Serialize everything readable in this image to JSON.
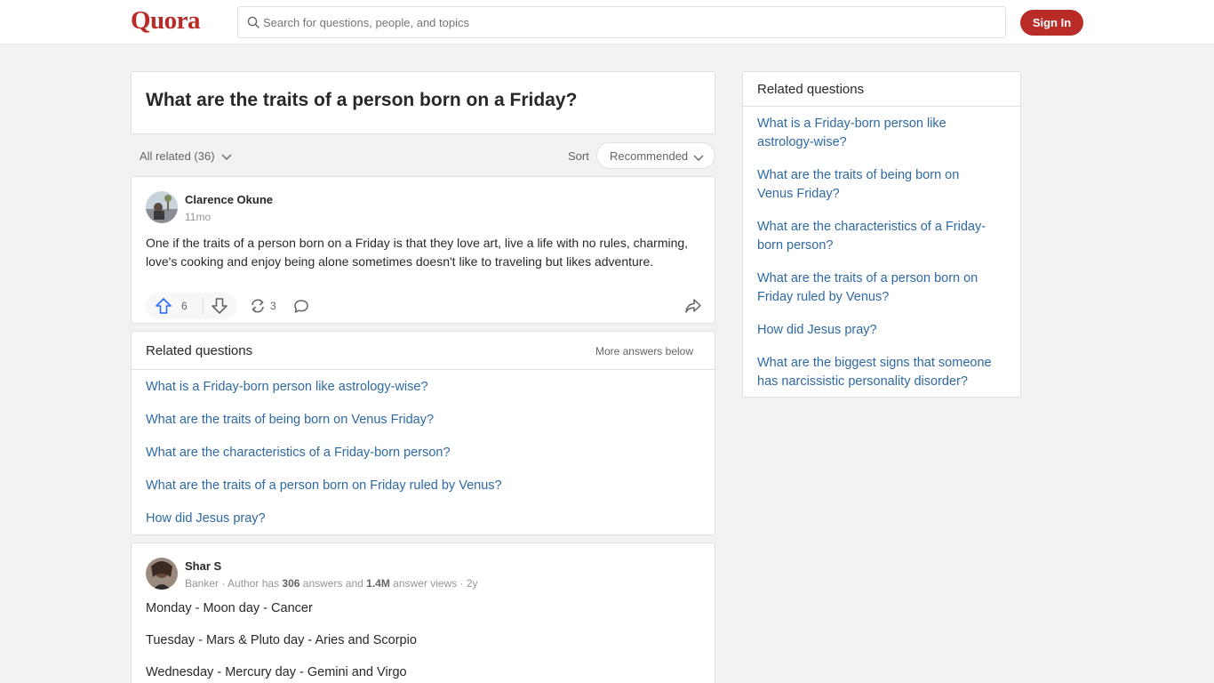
{
  "header": {
    "logo": "Quora",
    "search_placeholder": "Search for questions, people, and topics",
    "signin_label": "Sign In"
  },
  "question": {
    "title": "What are the traits of a person born on a Friday?"
  },
  "filters": {
    "all_related": "All related (36)",
    "sort_label": "Sort",
    "sort_value": "Recommended"
  },
  "answer1": {
    "author": "Clarence Okune",
    "time": "11mo",
    "text": "One if the traits of a person born on a Friday is that they love art, live a life with no rules, charming, love's cooking and enjoy being alone sometimes doesn't like to traveling but likes adventure.",
    "upvotes": "6",
    "shares": "3"
  },
  "related_inline": {
    "title": "Related questions",
    "more": "More answers below",
    "items": [
      "What is a Friday-born person like astrology-wise?",
      "What are the traits of being born on Venus Friday?",
      "What are the characteristics of a Friday-born person?",
      "What are the traits of a person born on Friday ruled by Venus?",
      "How did Jesus pray?"
    ]
  },
  "answer2": {
    "author": "Shar S",
    "meta_prefix": "Banker · Author has ",
    "answers_count": "306",
    "meta_mid": " answers and ",
    "views": "1.4M",
    "meta_suffix": " answer views · 2y",
    "lines": [
      "Monday - Moon day - Cancer",
      "Tuesday - Mars & Pluto day - Aries and Scorpio",
      "Wednesday - Mercury day - Gemini and Virgo"
    ]
  },
  "sidebar": {
    "title": "Related questions",
    "items": [
      "What is a Friday-born person like astrology-wise?",
      "What are the traits of being born on Venus Friday?",
      "What are the characteristics of a Friday-born person?",
      "What are the traits of a person born on Friday ruled by Venus?",
      "How did Jesus pray?",
      "What are the biggest signs that someone has narcissistic personality disorder?"
    ]
  },
  "colors": {
    "brand": "#b92b27",
    "link": "#2e69a3",
    "background": "#f1f2f2"
  }
}
